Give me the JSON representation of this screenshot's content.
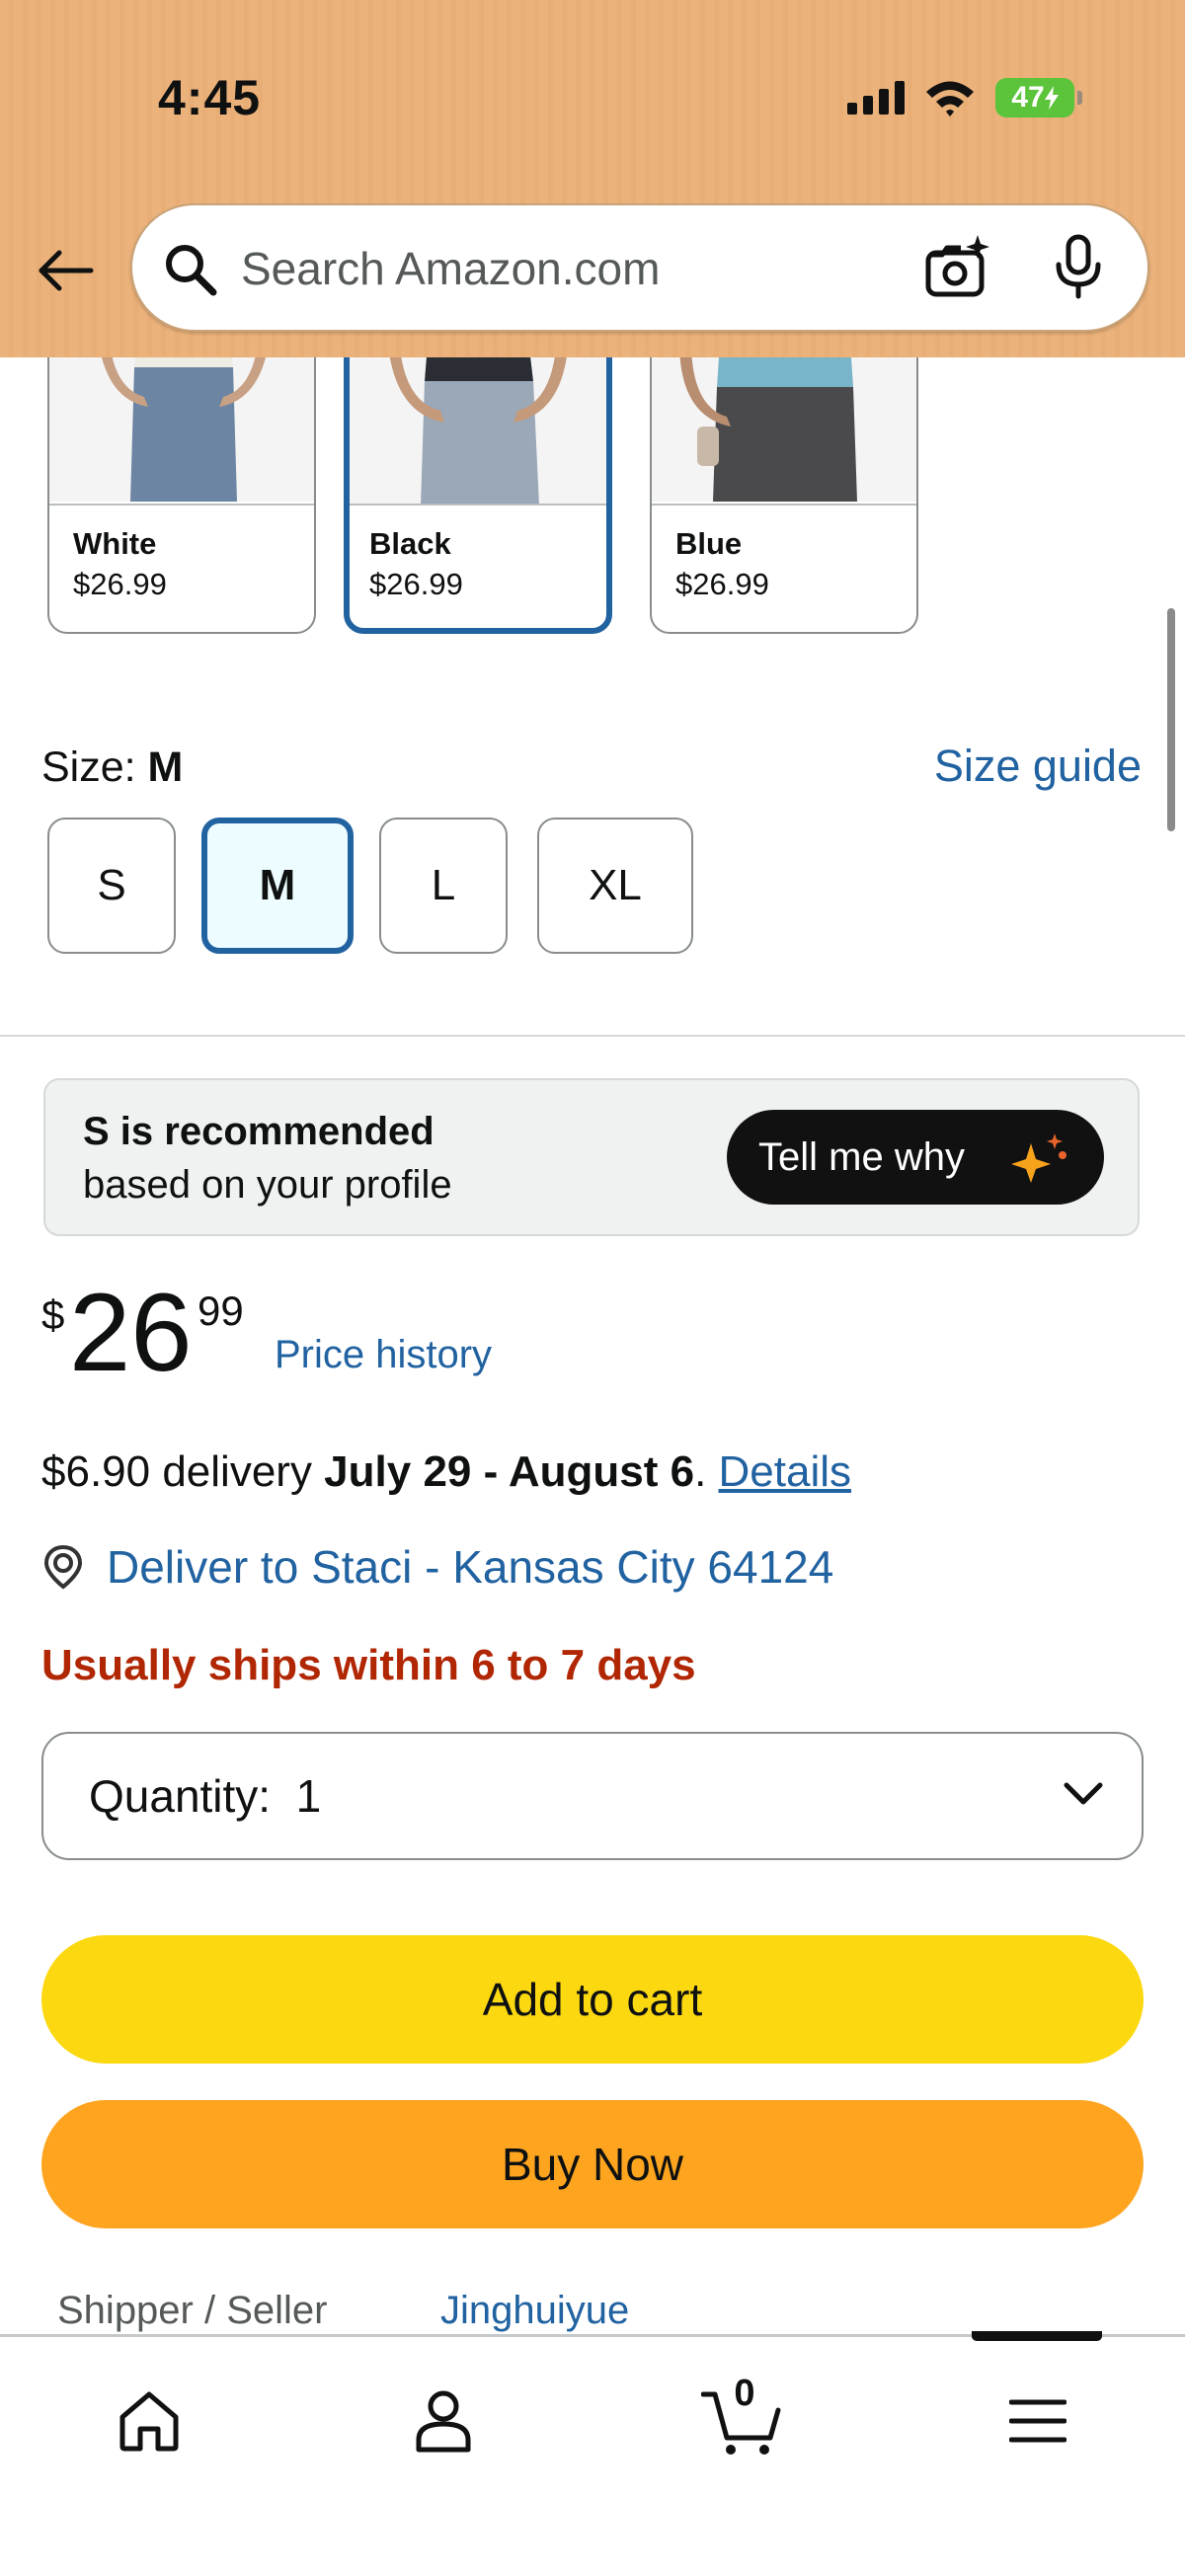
{
  "status_bar": {
    "time": "4:45",
    "battery": "47"
  },
  "search": {
    "placeholder": "Search Amazon.com"
  },
  "swatches": [
    {
      "name": "White",
      "price": "$26.99",
      "selected": false
    },
    {
      "name": "Black",
      "price": "$26.99",
      "selected": true
    },
    {
      "name": "Blue",
      "price": "$26.99",
      "selected": false
    }
  ],
  "size": {
    "label": "Size: ",
    "selected": "M",
    "guide_label": "Size guide",
    "options": [
      "S",
      "M",
      "L",
      "XL"
    ]
  },
  "recommendation": {
    "title": "S is recommended",
    "subtitle": "based on your profile",
    "button_label": "Tell me why"
  },
  "price": {
    "symbol": "$",
    "whole": "26",
    "fraction": "99",
    "history_label": "Price history"
  },
  "delivery": {
    "cost": "$6.90 delivery ",
    "dates": "July 29 - August 6",
    "period": ". ",
    "details_label": "Details"
  },
  "deliver_to": "Deliver to Staci - Kansas City 64124",
  "availability": "Usually ships within 6 to 7 days",
  "quantity": {
    "label": "Quantity:",
    "value": "1"
  },
  "actions": {
    "add_to_cart": "Add to cart",
    "buy_now": "Buy Now"
  },
  "seller": {
    "label": "Shipper / Seller",
    "name": "Jinghuiyue"
  },
  "bottom_nav": {
    "cart_count": "0"
  },
  "colors": {
    "header_bg": "#ebb27b",
    "link_blue": "#2162a1",
    "add_to_cart_yellow": "#fcd811",
    "buy_now_orange": "#fea41f",
    "availability_red": "#b12704"
  }
}
